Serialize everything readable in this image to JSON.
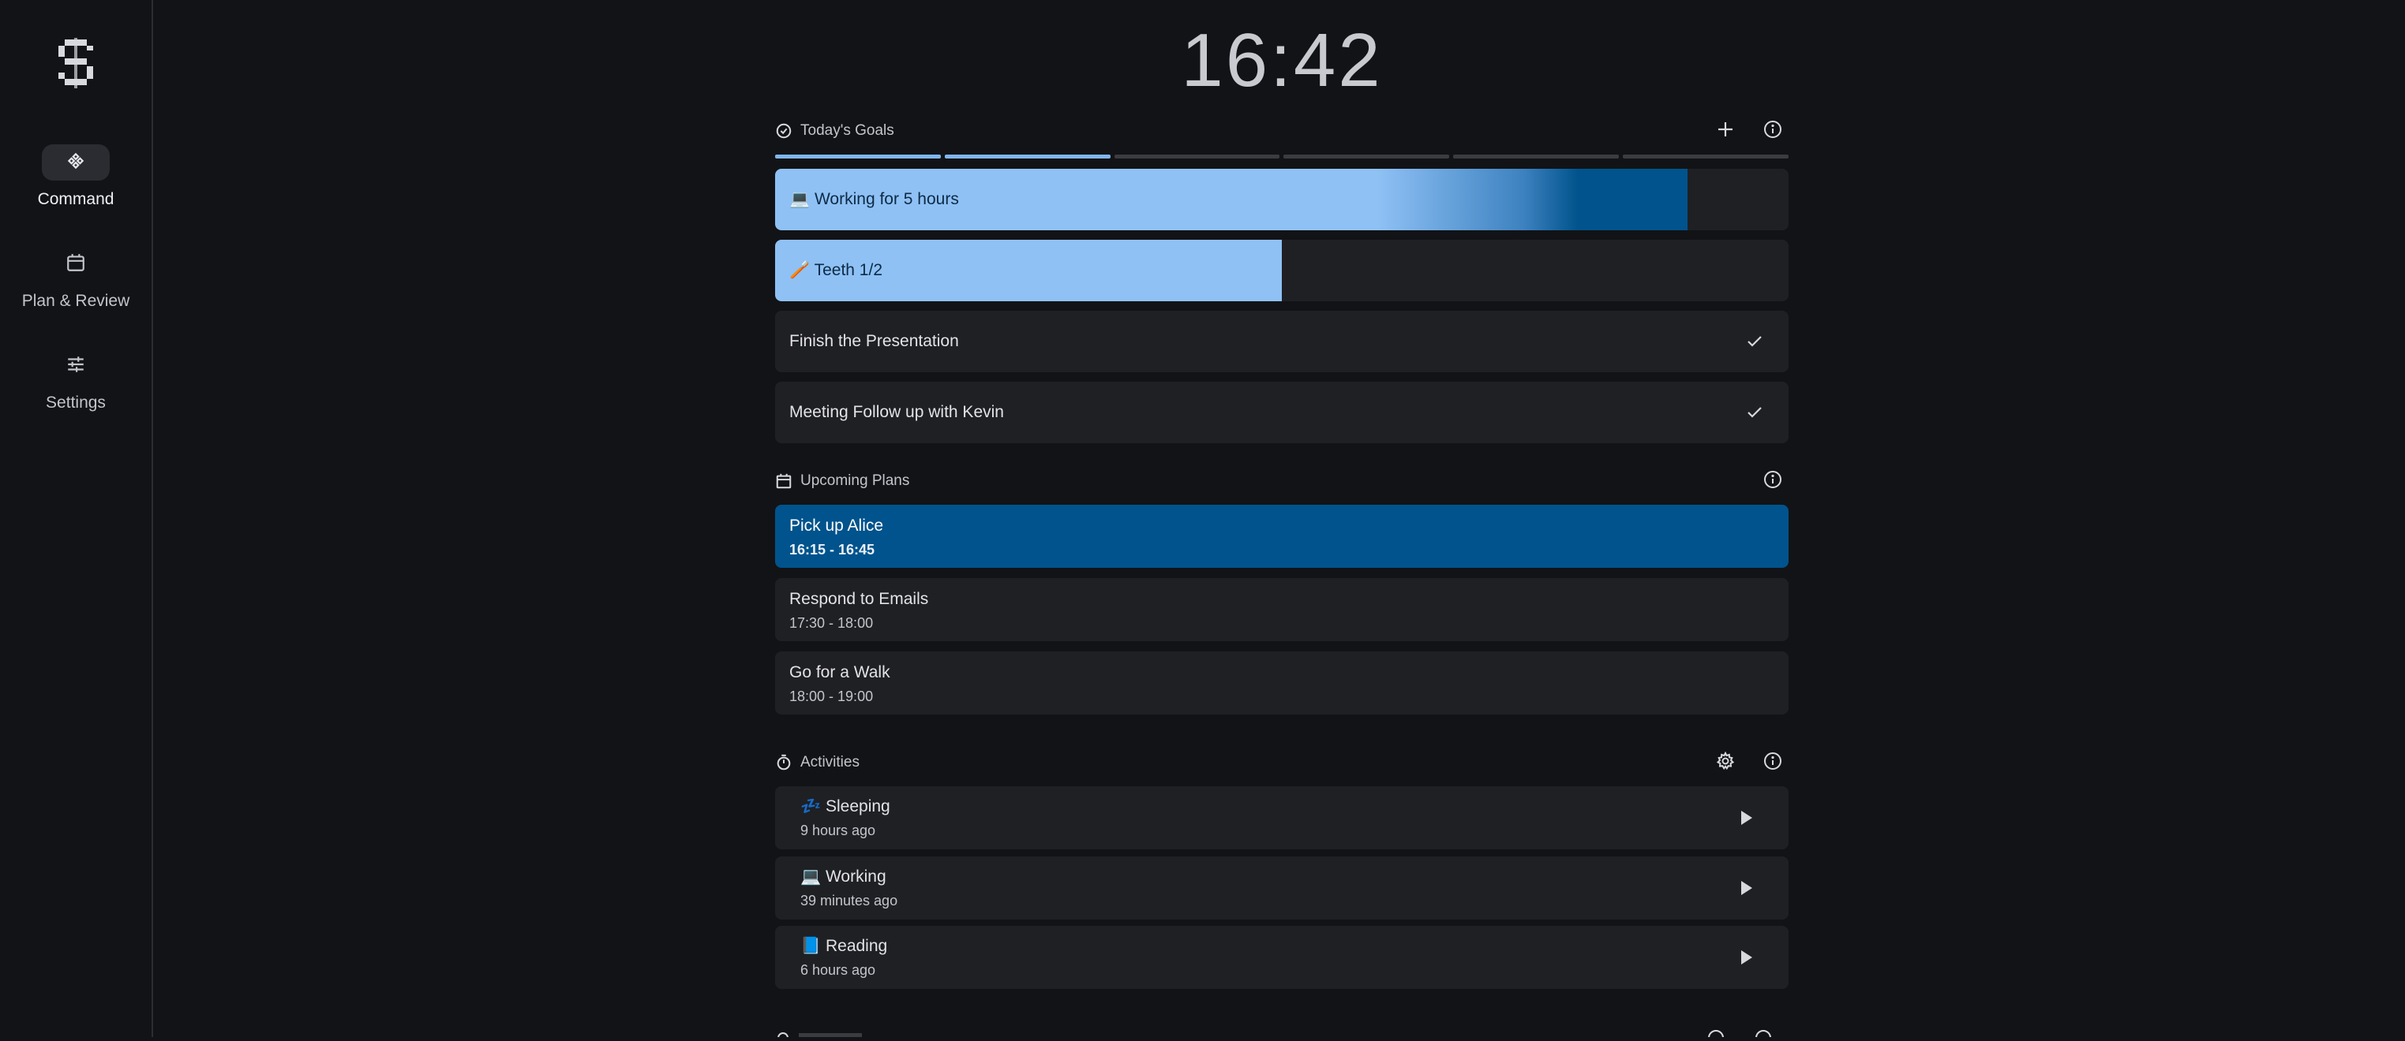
{
  "sidebar": {
    "logo_icon": "s-logo-icon",
    "items": [
      {
        "label": "Command",
        "icon": "gamepad-icon",
        "active": true
      },
      {
        "label": "Plan & Review",
        "icon": "calendar-icon",
        "active": false
      },
      {
        "label": "Settings",
        "icon": "sliders-icon",
        "active": false
      }
    ]
  },
  "clock": {
    "time": "16:42"
  },
  "goals": {
    "title": "Today's Goals",
    "icons": [
      "check-circle-icon",
      "plus-icon",
      "info-icon"
    ],
    "progress_segments": {
      "total": 6,
      "completed": 2
    },
    "items": [
      {
        "label": "💻 Working for 5 hours",
        "progress": 0.9,
        "completed": false
      },
      {
        "label": "🪥 Teeth 1/2",
        "progress": 0.5,
        "completed": false
      },
      {
        "label": "Finish the Presentation",
        "progress": 0,
        "completed": true
      },
      {
        "label": "Meeting Follow up with Kevin",
        "progress": 0,
        "completed": true
      }
    ]
  },
  "plans": {
    "title": "Upcoming Plans",
    "icons": [
      "calendar-icon",
      "info-icon"
    ],
    "items": [
      {
        "title": "Pick up Alice",
        "time": "16:15 - 16:45",
        "current": true
      },
      {
        "title": "Respond to Emails",
        "time": "17:30 - 18:00",
        "current": false
      },
      {
        "title": "Go for a Walk",
        "time": "18:00 - 19:00",
        "current": false
      }
    ]
  },
  "activities": {
    "title": "Activities",
    "icons": [
      "timer-icon",
      "gear-icon",
      "info-icon"
    ],
    "items": [
      {
        "title": "💤 Sleeping",
        "subtitle": "9 hours ago"
      },
      {
        "title": "💻 Working",
        "subtitle": "39 minutes ago"
      },
      {
        "title": "📘 Reading",
        "subtitle": "6 hours ago"
      }
    ]
  },
  "colors": {
    "background": "#121316",
    "card": "#1f2024",
    "accent_light": "#8fc1f5",
    "accent_dark": "#00538c"
  }
}
